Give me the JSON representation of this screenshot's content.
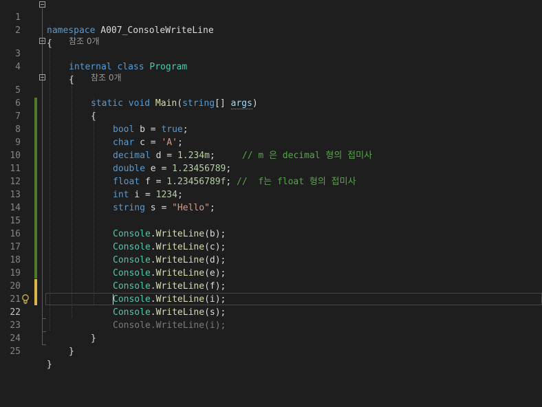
{
  "editor": {
    "lines": [
      {
        "n": "1"
      },
      {
        "n": "2"
      },
      {
        "n": "3"
      },
      {
        "n": "4"
      },
      {
        "n": "5"
      },
      {
        "n": "6"
      },
      {
        "n": "7"
      },
      {
        "n": "8"
      },
      {
        "n": "9"
      },
      {
        "n": "10"
      },
      {
        "n": "11"
      },
      {
        "n": "12"
      },
      {
        "n": "13"
      },
      {
        "n": "14"
      },
      {
        "n": "15"
      },
      {
        "n": "16"
      },
      {
        "n": "17"
      },
      {
        "n": "18"
      },
      {
        "n": "19"
      },
      {
        "n": "20"
      },
      {
        "n": "21"
      },
      {
        "n": "22"
      },
      {
        "n": "23"
      },
      {
        "n": "24"
      },
      {
        "n": "25"
      }
    ],
    "codelens_ref": "참조 0개",
    "code": {
      "l1_kw": "namespace",
      "l1_name": " A007_ConsoleWriteLine",
      "open_brace": "{",
      "close_brace": "}",
      "l3_kw": "internal class",
      "l3_name": " Program",
      "l5_kw1": "static void",
      "l5_method": " Main",
      "l5_paren": "(",
      "l5_kw2": "string",
      "l5_arr": "[] ",
      "l5_param": "args",
      "l5_close": ")",
      "l7_kw": "bool",
      "l7_rest": " b = ",
      "l7_val": "true",
      "l7_end": ";",
      "l8_kw": "char",
      "l8_rest": " c = ",
      "l8_val": "'A'",
      "l8_end": ";",
      "l9_kw": "decimal",
      "l9_rest": " d = ",
      "l9_val": "1.234m",
      "l9_end": ";",
      "l9_comment": "     // m 은 decimal 형의 접미사",
      "l10_kw": "double",
      "l10_rest": " e = ",
      "l10_val": "1.23456789",
      "l10_end": ";",
      "l11_kw": "float",
      "l11_rest": " f = ",
      "l11_val": "1.23456789f",
      "l11_end": ";",
      "l11_comment": " //  f는 float 형의 접미사",
      "l12_kw": "int",
      "l12_rest": " i = ",
      "l12_val": "1234",
      "l12_end": ";",
      "l13_kw": "string",
      "l13_rest": " s = ",
      "l13_val": "\"Hello\"",
      "l13_end": ";",
      "console": "Console",
      "dot": ".",
      "writeline": "WriteLine",
      "arg_b": "(b);",
      "arg_c": "(c);",
      "arg_d": "(d);",
      "arg_e": "(e);",
      "arg_f": "(f);",
      "arg_i": "(i);",
      "arg_s": "(s);",
      "ghost_line": "Console.WriteLine(i);"
    }
  },
  "colors": {
    "background": "#1e1e1e",
    "keyword": "#569cd6",
    "type": "#4ec9b0",
    "method": "#dcdcaa",
    "string": "#d69d85",
    "number": "#b5cea8",
    "comment": "#57a64a",
    "saved_change": "#4f7a28",
    "unsaved_change": "#d8b64a"
  },
  "icons": {
    "collapse": "collapse-minus-icon",
    "lightbulb": "lightbulb-icon"
  }
}
